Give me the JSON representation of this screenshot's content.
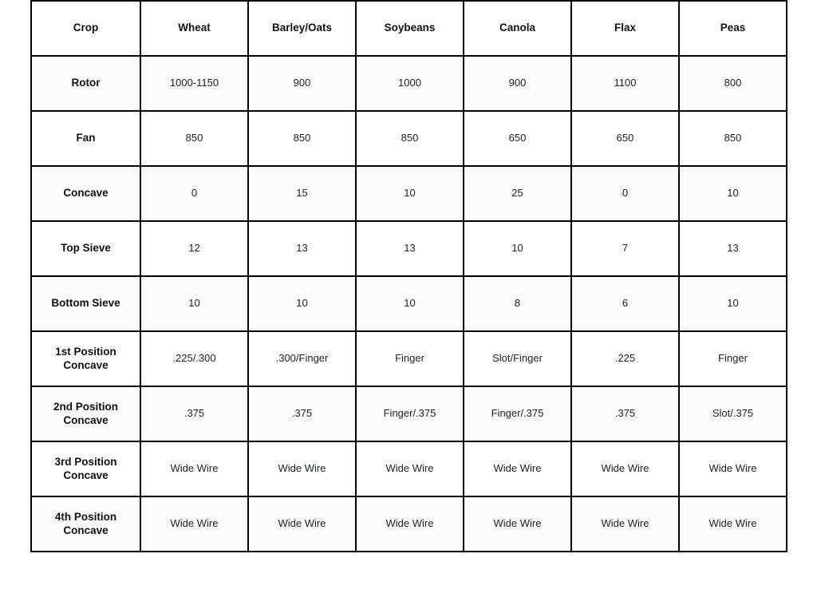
{
  "table": {
    "columns": [
      "Crop",
      "Wheat",
      "Barley/Oats",
      "Soybeans",
      "Canola",
      "Flax",
      "Peas"
    ],
    "rows": [
      {
        "label": "Rotor",
        "values": [
          "1000-1150",
          "900",
          "1000",
          "900",
          "1100",
          "800"
        ]
      },
      {
        "label": "Fan",
        "values": [
          "850",
          "850",
          "850",
          "650",
          "650",
          "850"
        ]
      },
      {
        "label": "Concave",
        "values": [
          "0",
          "15",
          "10",
          "25",
          "0",
          "10"
        ]
      },
      {
        "label": "Top Sieve",
        "values": [
          "12",
          "13",
          "13",
          "10",
          "7",
          "13"
        ]
      },
      {
        "label": "Bottom Sieve",
        "values": [
          "10",
          "10",
          "10",
          "8",
          "6",
          "10"
        ]
      },
      {
        "label": "1st Position  Concave",
        "values": [
          ".225/.300",
          ".300/Finger",
          "Finger",
          "Slot/Finger",
          ".225",
          "Finger"
        ]
      },
      {
        "label": "2nd Position Concave",
        "values": [
          ".375",
          ".375",
          "Finger/.375",
          "Finger/.375",
          ".375",
          "Slot/.375"
        ]
      },
      {
        "label": "3rd Position Concave",
        "values": [
          "Wide Wire",
          "Wide Wire",
          "Wide Wire",
          "Wide Wire",
          "Wide Wire",
          "Wide Wire"
        ]
      },
      {
        "label": "4th Position Concave",
        "values": [
          "Wide Wire",
          "Wide Wire",
          "Wide Wire",
          "Wide Wire",
          "Wide Wire",
          "Wide Wire"
        ]
      }
    ]
  },
  "style": {
    "border_color": "#000000",
    "text_color": "#202124",
    "header_text_color": "#111111",
    "row_tint": "#fafafa",
    "page_background": "#ffffff"
  },
  "chart_data": {
    "type": "table",
    "title": "",
    "columns": [
      "Crop",
      "Wheat",
      "Barley/Oats",
      "Soybeans",
      "Canola",
      "Flax",
      "Peas"
    ],
    "rows": [
      [
        "Rotor",
        "1000-1150",
        "900",
        "1000",
        "900",
        "1100",
        "800"
      ],
      [
        "Fan",
        "850",
        "850",
        "850",
        "650",
        "650",
        "850"
      ],
      [
        "Concave",
        "0",
        "15",
        "10",
        "25",
        "0",
        "10"
      ],
      [
        "Top Sieve",
        "12",
        "13",
        "13",
        "10",
        "7",
        "13"
      ],
      [
        "Bottom Sieve",
        "10",
        "10",
        "10",
        "8",
        "6",
        "10"
      ],
      [
        "1st Position  Concave",
        ".225/.300",
        ".300/Finger",
        "Finger",
        "Slot/Finger",
        ".225",
        "Finger"
      ],
      [
        "2nd Position Concave",
        ".375",
        ".375",
        "Finger/.375",
        "Finger/.375",
        ".375",
        "Slot/.375"
      ],
      [
        "3rd Position Concave",
        "Wide Wire",
        "Wide Wire",
        "Wide Wire",
        "Wide Wire",
        "Wide Wire",
        "Wide Wire"
      ],
      [
        "4th Position Concave",
        "Wide Wire",
        "Wide Wire",
        "Wide Wire",
        "Wide Wire",
        "Wide Wire",
        "Wide Wire"
      ]
    ]
  }
}
